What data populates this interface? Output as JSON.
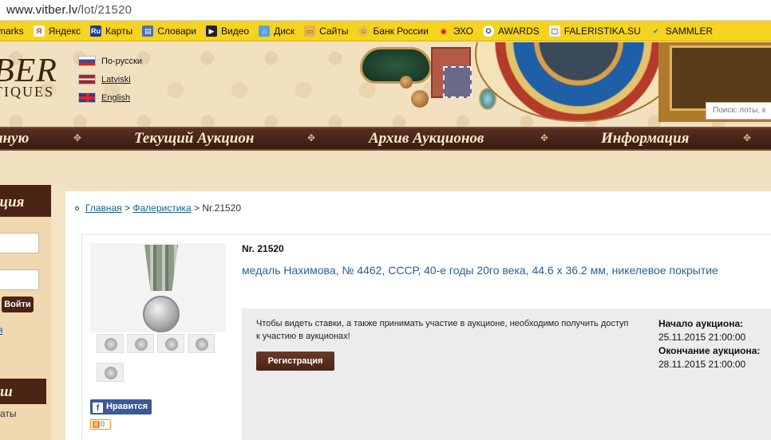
{
  "browser": {
    "url_host": "www.vitber.lv",
    "url_path": "/lot/21520"
  },
  "bookmarks": [
    {
      "label": "marks",
      "icon": "bookmarks-icon"
    },
    {
      "label": "Яндекс",
      "icon": "yandex-icon"
    },
    {
      "label": "Карты",
      "icon": "ru-icon"
    },
    {
      "label": "Словари",
      "icon": "dictionary-icon"
    },
    {
      "label": "Видео",
      "icon": "video-icon"
    },
    {
      "label": "Диск",
      "icon": "disk-icon"
    },
    {
      "label": "Сайты",
      "icon": "folder-icon"
    },
    {
      "label": "Банк России",
      "icon": "bank-icon"
    },
    {
      "label": "ЭХО",
      "icon": "echo-icon"
    },
    {
      "label": "AWARDS",
      "icon": "awards-icon"
    },
    {
      "label": "FALERISTIKA.SU",
      "icon": "faleristika-icon"
    },
    {
      "label": "SAMMLER",
      "icon": "sammler-icon"
    }
  ],
  "header": {
    "logo_top": "BER",
    "logo_bottom": "TIQUES",
    "languages": [
      {
        "label": "По-русски",
        "flag": "ru"
      },
      {
        "label": "Latviski",
        "flag": "lv"
      },
      {
        "label": "English",
        "flag": "en"
      }
    ],
    "search_placeholder": "Поиск: лоты, к"
  },
  "nav": {
    "items": [
      "аную",
      "Текущий Аукцион",
      "Архив Аукционов",
      "Информация"
    ]
  },
  "sidebar": {
    "heading": "ация",
    "login_button": "Войти",
    "link": "я",
    "heading2": "ш",
    "text": "аты"
  },
  "breadcrumb": {
    "home": "Главная",
    "category": "Фалеристика",
    "current": "Nr.21520"
  },
  "lot": {
    "number": "Nr. 21520",
    "title": "медаль Нахимова, № 4462, СССР, 40-е годы 20го века, 44.6 x 36.2 мм, никелевое покрытие",
    "notice": "Чтобы видеть ставки, а также принимать участие в аукционе, необходимо получить доступ к участию в аукционах!",
    "register_button": "Регистрация",
    "start_label": "Начало аукциона:",
    "start_value": "25.11.2015 21:00:00",
    "end_label": "Окончание аукциона:",
    "end_value": "28.11.2015 21:00:00"
  },
  "social": {
    "facebook_label": "Нравится",
    "ok_count": "0"
  },
  "colors": {
    "bookmark_bar": "#f5d320",
    "nav_bg": "#4b2416",
    "link": "#1a5f8a",
    "lot_title": "#2a5f9a"
  }
}
